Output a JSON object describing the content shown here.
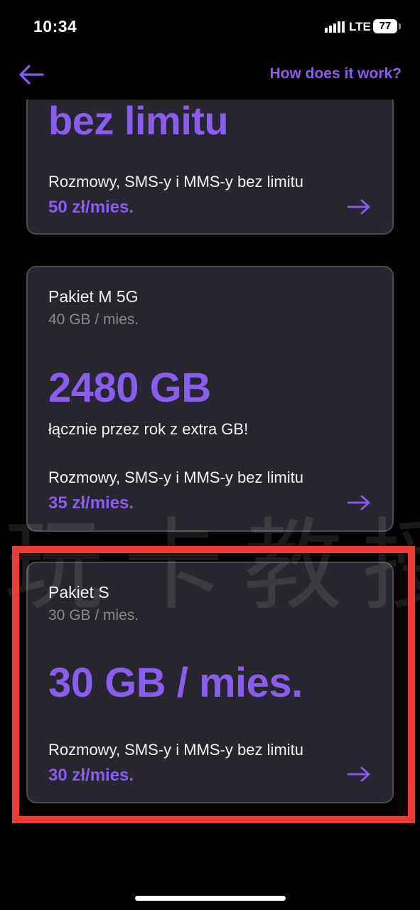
{
  "status_bar": {
    "time": "10:34",
    "network": "LTE",
    "battery": "77"
  },
  "header": {
    "back_icon": "arrow-left-icon",
    "help_link": "How does it work?"
  },
  "plans": [
    {
      "name": "",
      "data": "",
      "headline": "bez limitu",
      "extra": "",
      "calls": "Rozmowy, SMS-y i MMS-y bez limitu",
      "price": "50 zł/mies."
    },
    {
      "name": "Pakiet M 5G",
      "data": "40 GB / mies.",
      "headline": "2480 GB",
      "extra": "łącznie przez rok z extra GB!",
      "calls": "Rozmowy, SMS-y i MMS-y bez limitu",
      "price": "35 zł/mies."
    },
    {
      "name": "Pakiet S",
      "data": "30 GB / mies.",
      "headline": "30 GB / mies.",
      "extra": "",
      "calls": "Rozmowy, SMS-y i MMS-y bez limitu",
      "price": "30 zł/mies."
    }
  ],
  "watermark": "玩卡教授",
  "colors": {
    "accent": "#8a5cf0",
    "card_bg": "#27252d",
    "card_border": "#4c4a52",
    "highlight": "#ef3b34",
    "background": "#000000"
  }
}
